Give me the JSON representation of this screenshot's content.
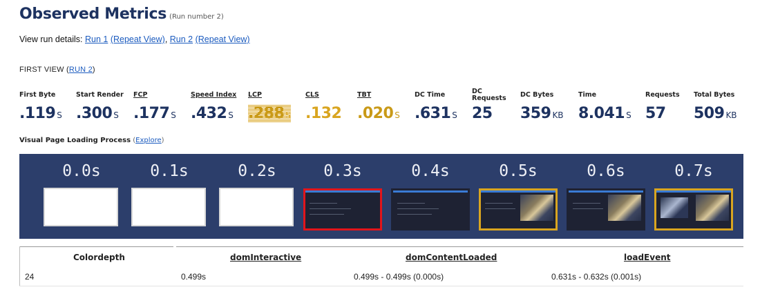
{
  "header": {
    "title": "Observed Metrics",
    "subtitle": "(Run number 2)"
  },
  "run_details": {
    "prefix": "View run details:",
    "links": [
      "Run 1",
      "(Repeat View)",
      "Run 2",
      "(Repeat View)"
    ],
    "sep1": " ",
    "sep2": ", ",
    "sep3": " "
  },
  "first_view": {
    "label": "FIRST VIEW (",
    "link": "RUN 2",
    "close": ")"
  },
  "metrics": [
    {
      "label": "First Byte",
      "value": ".119",
      "unit": "S"
    },
    {
      "label": "Start Render",
      "value": ".300",
      "unit": "S"
    },
    {
      "label": "FCP",
      "value": ".177",
      "unit": "S"
    },
    {
      "label": "Speed Index",
      "value": ".432",
      "unit": "S"
    },
    {
      "label": "LCP",
      "value": ".288",
      "unit": "S"
    },
    {
      "label": "CLS",
      "value": ".132",
      "unit": ""
    },
    {
      "label": "TBT",
      "value": ".020",
      "unit": "S"
    },
    {
      "label": "DC Time",
      "value": ".631",
      "unit": "S"
    },
    {
      "label": "DC Requests",
      "value": "25",
      "unit": ""
    },
    {
      "label": "DC Bytes",
      "value": "359",
      "unit": "KB"
    },
    {
      "label": "Time",
      "value": "8.041",
      "unit": "S"
    },
    {
      "label": "Requests",
      "value": "57",
      "unit": ""
    },
    {
      "label": "Total Bytes",
      "value": "509",
      "unit": "KB"
    }
  ],
  "visual_loading": {
    "label": "Visual Page Loading Process",
    "paren_open": " (",
    "link": "Explore",
    "paren_close": ")"
  },
  "filmstrip": [
    {
      "time": "0.0s",
      "state": "blank"
    },
    {
      "time": "0.1s",
      "state": "blank"
    },
    {
      "time": "0.2s",
      "state": "blank"
    },
    {
      "time": "0.3s",
      "state": "dark-red"
    },
    {
      "time": "0.4s",
      "state": "dark"
    },
    {
      "time": "0.5s",
      "state": "gold-image"
    },
    {
      "time": "0.6s",
      "state": "image"
    },
    {
      "time": "0.7s",
      "state": "gold-image2"
    }
  ],
  "table": {
    "headers": [
      "Colordepth",
      "domInteractive",
      "domContentLoaded",
      "loadEvent"
    ],
    "row": [
      "24",
      "0.499s",
      "0.499s - 0.499s (0.000s)",
      "0.631s - 0.632s (0.001s)"
    ]
  },
  "colors": {
    "title": "#1d3260",
    "link": "#1b5bbf",
    "warn": "#d9a520",
    "strip": "#2c3e6b",
    "highlight_red": "#e2151b"
  }
}
